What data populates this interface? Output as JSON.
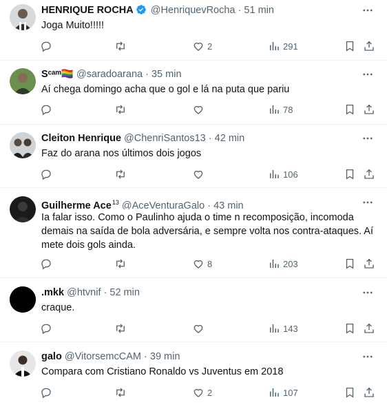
{
  "colors": {
    "verified": "#1d9bf0",
    "text": "#0f1419",
    "muted": "#536471",
    "divider": "#eff3f4"
  },
  "tweets": [
    {
      "name": "HENRIQUE ROCHA",
      "verified": true,
      "handle": "@HenriquevRocha",
      "separator": "·",
      "time": "51 min",
      "text": "Joga Muito!!!!!",
      "likes": "2",
      "views": "291"
    },
    {
      "name": "Sᶜᵃᵐ🏳️‍🌈",
      "handle": "@saradoarana",
      "separator": "·",
      "time": "35 min",
      "text": "Aí chega domingo acha que o gol e lá na puta que pariu",
      "likes": "",
      "views": "78"
    },
    {
      "name": "Cleiton Henrique",
      "handle": "@ChenriSantos13",
      "separator": "·",
      "time": "42 min",
      "text": "Faz do arana nos últimos dois jogos",
      "likes": "",
      "views": "106"
    },
    {
      "name": "Guilherme Ace",
      "name_sup": "13",
      "handle": "@AceVenturaGalo",
      "separator": "·",
      "time": "43 min",
      "text": "Ia falar isso. Como o Paulinho ajuda o time n recomposição, incomoda demais na saída de bola adversária, e sempre volta nos contra-ataques. Aí mete dois gols ainda.",
      "likes": "8",
      "views": "203"
    },
    {
      "name": ".mkk",
      "handle": "@htvnif",
      "separator": "·",
      "time": "52 min",
      "text": "craque.",
      "likes": "",
      "views": "143"
    },
    {
      "name": "galo",
      "handle": "@VitorsemcCAM",
      "separator": "·",
      "time": "39 min",
      "text": "Compara com Cristiano Ronaldo vs Juventus em 2018",
      "likes": "2",
      "views": "107"
    }
  ]
}
